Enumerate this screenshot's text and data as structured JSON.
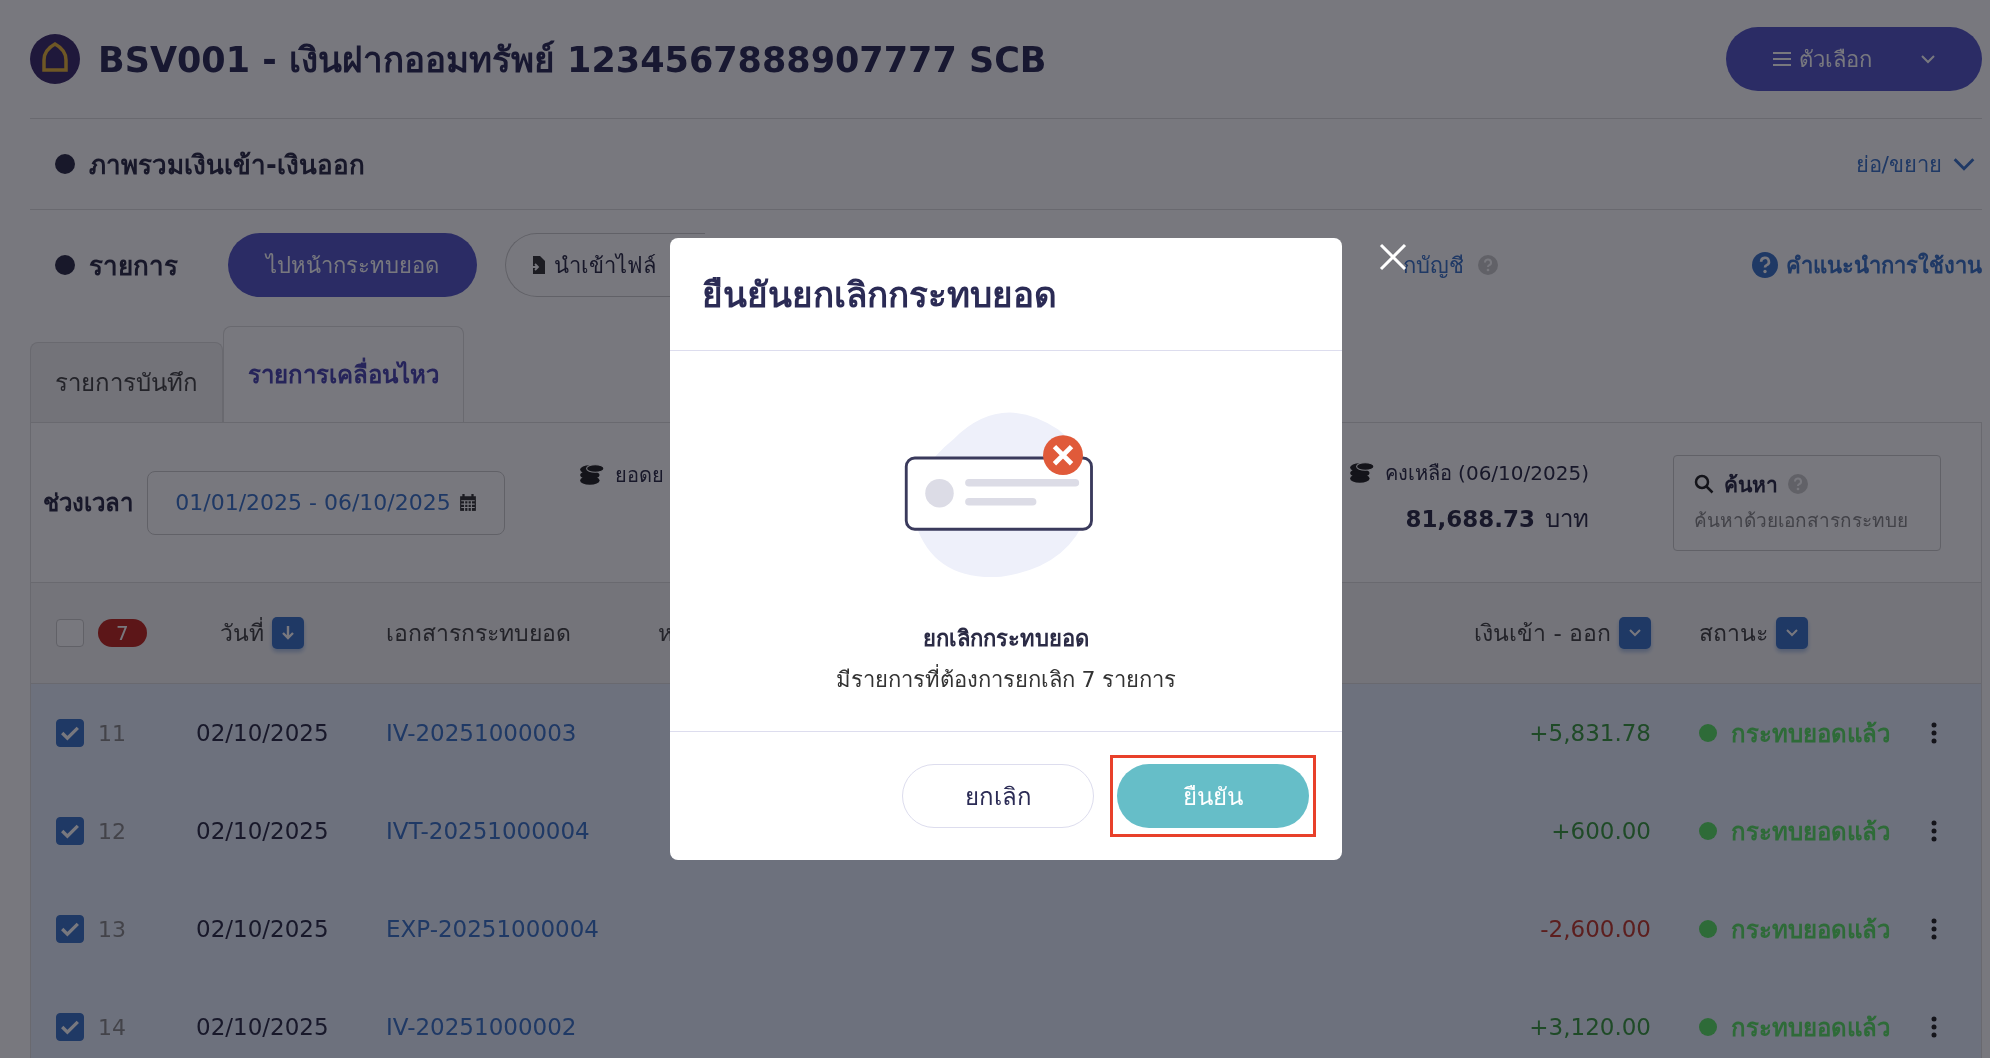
{
  "header": {
    "title": "BSV001 - เงินฝากออมทรัพย์ 1234567888907777 SCB",
    "options_button": "ตัวเลือก"
  },
  "overview": {
    "title": "ภาพรวมเงินเข้า-เงินออก",
    "toggle": "ย่อ/ขยาย"
  },
  "toolbar": {
    "title": "รายการ",
    "primary_button": "ไปหน้ากระทบยอด",
    "import_button": "นำเข้าไฟล์",
    "partial_link": "กบัญชี",
    "help_link": "คำแนะนำการใช้งาน"
  },
  "tabs": [
    {
      "label": "รายการบันทึก",
      "selected": false
    },
    {
      "label": "รายการเคลื่อนไหว",
      "selected": true
    }
  ],
  "filter": {
    "label": "ช่วงเวลา",
    "date_range": "01/01/2025 - 06/10/2025",
    "summary_label": "ยอดย",
    "balance_label": "คงเหลือ (06/10/2025)",
    "balance_value": "81,688.73",
    "balance_unit": "บาท",
    "search_label": "ค้นหา",
    "placeholder": "ค้นหาด้วยเอกสารกระทบย"
  },
  "table": {
    "select_all": false,
    "selected_count": "7",
    "columns": [
      "วันที่",
      "เอกสารกระทบยอด",
      "ห",
      "เงินเข้า - ออก",
      "สถานะ"
    ],
    "rows": [
      {
        "checked": true,
        "number": "11",
        "date": "02/10/2025",
        "document": "IV-20251000003",
        "amount": "+5,831.78",
        "kind": "in",
        "status": "กระทบยอดแล้ว",
        "color": "#2e6b38"
      },
      {
        "checked": true,
        "number": "12",
        "date": "02/10/2025",
        "document": "IVT-20251000004",
        "amount": "+600.00",
        "kind": "in",
        "status": "กระทบยอดแล้ว",
        "color": "#2e6b38"
      },
      {
        "checked": true,
        "number": "13",
        "date": "02/10/2025",
        "document": "EXP-20251000004",
        "amount": "-2,600.00",
        "kind": "out",
        "status": "กระทบยอดแล้ว",
        "color": "#2e6b38"
      },
      {
        "checked": true,
        "number": "14",
        "date": "02/10/2025",
        "document": "IV-20251000002",
        "amount": "+3,120.00",
        "kind": "in",
        "status": "กระทบยอดแล้ว",
        "color": "#2e6b38"
      }
    ]
  },
  "dialog": {
    "title": "ยืนยันยกเลิกกระทบยอด",
    "heading": "ยกเลิกกระทบยอด",
    "message": "มีรายการที่ต้องการยกเลิก 7 รายการ",
    "cancel_button": "ยกเลิก",
    "confirm_button": "ยืนยัน",
    "confirm_highlighted": true
  }
}
